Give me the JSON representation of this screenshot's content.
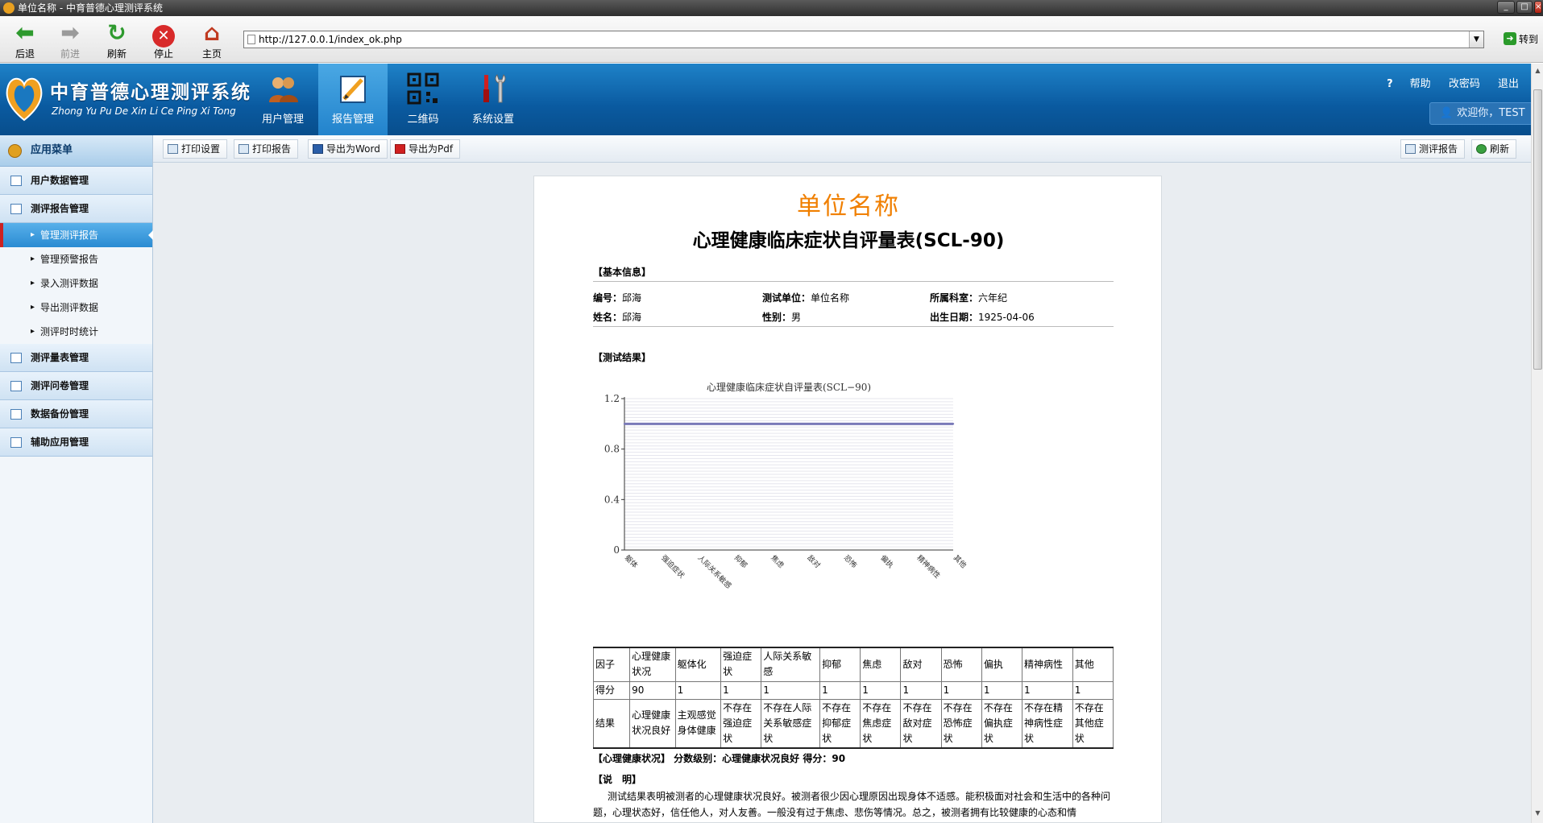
{
  "window": {
    "title": "单位名称 - 中育普德心理测评系统"
  },
  "browser": {
    "back": "后退",
    "forward": "前进",
    "refresh": "刷新",
    "stop": "停止",
    "home": "主页",
    "url": "http://127.0.0.1/index_ok.php",
    "go": "转到"
  },
  "app": {
    "title": "中育普德心理测评系统",
    "subtitle": "Zhong Yu Pu De Xin Li Ce Ping Xi Tong",
    "nav": [
      {
        "label": "用户管理"
      },
      {
        "label": "报告管理",
        "active": true
      },
      {
        "label": "二维码"
      },
      {
        "label": "系统设置"
      }
    ],
    "help": "帮助",
    "change_password": "改密码",
    "logout": "退出",
    "welcome": "欢迎你，TEST"
  },
  "sidebar": {
    "header": "应用菜单",
    "sections": [
      {
        "label": "用户数据管理"
      },
      {
        "label": "测评报告管理"
      }
    ],
    "subitems": [
      {
        "label": "管理测评报告",
        "active": true
      },
      {
        "label": "管理预警报告"
      },
      {
        "label": "录入测评数据"
      },
      {
        "label": "导出测评数据"
      },
      {
        "label": "测评时时统计"
      }
    ],
    "sections2": [
      {
        "label": "测评量表管理"
      },
      {
        "label": "测评问卷管理"
      },
      {
        "label": "数据备份管理"
      },
      {
        "label": "辅助应用管理"
      }
    ]
  },
  "toolbar": {
    "print_settings": "打印设置",
    "print_report": "打印报告",
    "export_word": "导出为Word",
    "export_pdf": "导出为Pdf",
    "assess_report": "测评报告",
    "refresh": "刷新"
  },
  "report": {
    "unit_name": "单位名称",
    "scale_title": "心理健康临床症状自评量表(SCL-90)",
    "basic_info_header": "【基本信息】",
    "id_label": "编号：",
    "id_value": "邱海",
    "unit_label": "测试单位：",
    "unit_value": "单位名称",
    "dept_label": "所属科室：",
    "dept_value": "六年纪",
    "name_label": "姓名：",
    "name_value": "邱海",
    "sex_label": "性别：",
    "sex_value": "男",
    "birth_label": "出生日期：",
    "birth_value": "1925-04-06",
    "result_header": "【测试结果】",
    "table": {
      "headers": [
        "因子",
        "心理健康状况",
        "躯体化",
        "强迫症状",
        "人际关系敏感",
        "抑郁",
        "焦虑",
        "敌对",
        "恐怖",
        "偏执",
        "精神病性",
        "其他"
      ],
      "scores": [
        "得分",
        "90",
        "1",
        "1",
        "1",
        "1",
        "1",
        "1",
        "1",
        "1",
        "1",
        "1"
      ],
      "results": [
        "结果",
        "心理健康状况良好",
        "主观感觉身体健康",
        "不存在强迫症状",
        "不存在人际关系敏感症状",
        "不存在抑郁症状",
        "不存在焦虑症状",
        "不存在敌对症状",
        "不存在恐怖症状",
        "不存在偏执症状",
        "不存在精神病性症状",
        "不存在其他症状"
      ]
    },
    "summary": "【心理健康状况】 分数级别：心理健康状况良好  得分：90",
    "explain_header": "【说　明】",
    "explain_text": "测试结果表明被测者的心理健康状况良好。被测者很少因心理原因出现身体不适感。能积极面对社会和生活中的各种问题，心理状态好，信任他人，对人友善。一般没有过于焦虑、悲伤等情况。总之，被测者拥有比较健康的心态和情"
  },
  "chart_data": {
    "type": "line",
    "title": "心理健康临床症状自评量表(SCL−90)",
    "categories": [
      "躯体",
      "强迫症状",
      "人际关系敏感",
      "抑郁",
      "焦虑",
      "敌对",
      "恐怖",
      "偏执",
      "精神病性",
      "其他"
    ],
    "series": [
      {
        "values": [
          1,
          1,
          1,
          1,
          1,
          1,
          1,
          1,
          1,
          1
        ]
      }
    ],
    "yticks": [
      "0",
      "0.4",
      "0.8",
      "1.2"
    ],
    "ylim": [
      0,
      1.2
    ],
    "grid": true,
    "line_color": "#7a7ab8"
  }
}
